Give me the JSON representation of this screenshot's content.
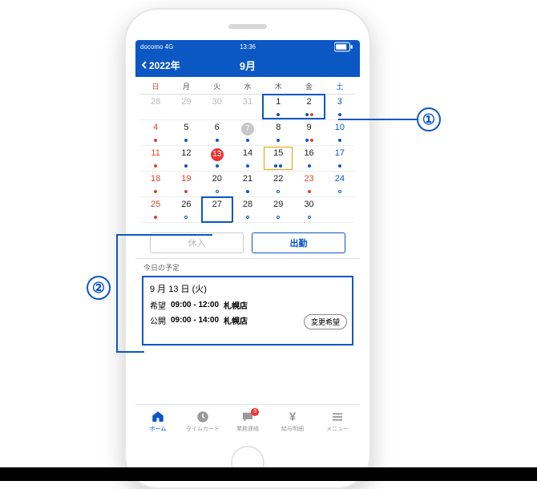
{
  "status": {
    "carrier": "docomo 4G",
    "time": "13:36"
  },
  "header": {
    "back": "2022年",
    "month": "9月"
  },
  "dow": [
    "日",
    "月",
    "火",
    "水",
    "木",
    "金",
    "土"
  ],
  "weeks": [
    [
      {
        "n": "28",
        "cls": "muted"
      },
      {
        "n": "29",
        "cls": "muted"
      },
      {
        "n": "30",
        "cls": "muted"
      },
      {
        "n": "31",
        "cls": "muted"
      },
      {
        "n": "1",
        "cls": "norm",
        "dots": [
          "db"
        ]
      },
      {
        "n": "2",
        "cls": "norm",
        "dots": [
          "db",
          "dr"
        ]
      },
      {
        "n": "3",
        "cls": "sat",
        "dots": [
          "db"
        ]
      }
    ],
    [
      {
        "n": "4",
        "cls": "sun",
        "dots": [
          "dr"
        ]
      },
      {
        "n": "5",
        "cls": "norm",
        "dots": [
          "db"
        ]
      },
      {
        "n": "6",
        "cls": "norm",
        "dots": [
          "db"
        ]
      },
      {
        "n": "7",
        "pill": "gray",
        "dots": [
          "db"
        ]
      },
      {
        "n": "8",
        "cls": "norm",
        "dots": [
          "db"
        ]
      },
      {
        "n": "9",
        "cls": "norm",
        "dots": [
          "db",
          "dr"
        ]
      },
      {
        "n": "10",
        "cls": "sat",
        "dots": [
          "db"
        ]
      }
    ],
    [
      {
        "n": "11",
        "cls": "sun",
        "dots": [
          "dr"
        ]
      },
      {
        "n": "12",
        "cls": "norm",
        "dots": [
          "db"
        ]
      },
      {
        "n": "13",
        "pill": "red",
        "dots": [
          "db"
        ]
      },
      {
        "n": "14",
        "cls": "norm",
        "dots": [
          "db"
        ]
      },
      {
        "n": "15",
        "cls": "norm",
        "dots": [
          "db",
          "db"
        ],
        "orange": true
      },
      {
        "n": "16",
        "cls": "norm",
        "dots": [
          "db"
        ]
      },
      {
        "n": "17",
        "cls": "sat",
        "dots": [
          "db"
        ]
      }
    ],
    [
      {
        "n": "18",
        "cls": "sun",
        "dots": [
          "dr"
        ]
      },
      {
        "n": "19",
        "cls": "sun",
        "dots": [
          "dr"
        ]
      },
      {
        "n": "20",
        "cls": "norm",
        "dots": [
          "ring"
        ]
      },
      {
        "n": "21",
        "cls": "norm",
        "dots": [
          "db"
        ]
      },
      {
        "n": "22",
        "cls": "norm",
        "dots": [
          "ring"
        ]
      },
      {
        "n": "23",
        "cls": "sun",
        "dots": [
          "dr"
        ]
      },
      {
        "n": "24",
        "cls": "sat",
        "dots": [
          "ring"
        ]
      }
    ],
    [
      {
        "n": "25",
        "cls": "sun",
        "dots": [
          "dr"
        ]
      },
      {
        "n": "26",
        "cls": "norm",
        "dots": [
          "ring"
        ]
      },
      {
        "n": "27",
        "cls": "norm",
        "dots": []
      },
      {
        "n": "28",
        "cls": "norm",
        "dots": [
          "ring"
        ]
      },
      {
        "n": "29",
        "cls": "norm",
        "dots": [
          "ring"
        ]
      },
      {
        "n": "30",
        "cls": "norm",
        "dots": [
          "ring"
        ]
      },
      {
        "n": "",
        "cls": "muted"
      }
    ]
  ],
  "buttons": {
    "rest": "休入",
    "attend": "出勤"
  },
  "section_title": "今日の予定",
  "schedule": {
    "date": "9 月 13 日 (火)",
    "rows": [
      {
        "tag": "希望",
        "time": "09:00 - 12:00",
        "place": "札幌店"
      },
      {
        "tag": "公開",
        "time": "09:00 - 14:00",
        "place": "札幌店"
      }
    ],
    "change": "変更希望"
  },
  "tabs": [
    {
      "label": "ホーム",
      "icon": "home",
      "active": true
    },
    {
      "label": "タイムカード",
      "icon": "clock"
    },
    {
      "label": "業務連絡",
      "icon": "chat",
      "badge": "3"
    },
    {
      "label": "給与明細",
      "icon": "yen"
    },
    {
      "label": "メニュー",
      "icon": "menu"
    }
  ],
  "callouts": {
    "one": "①",
    "two": "②"
  },
  "colors": {
    "brand": "#0b57c4",
    "danger": "#e33"
  }
}
